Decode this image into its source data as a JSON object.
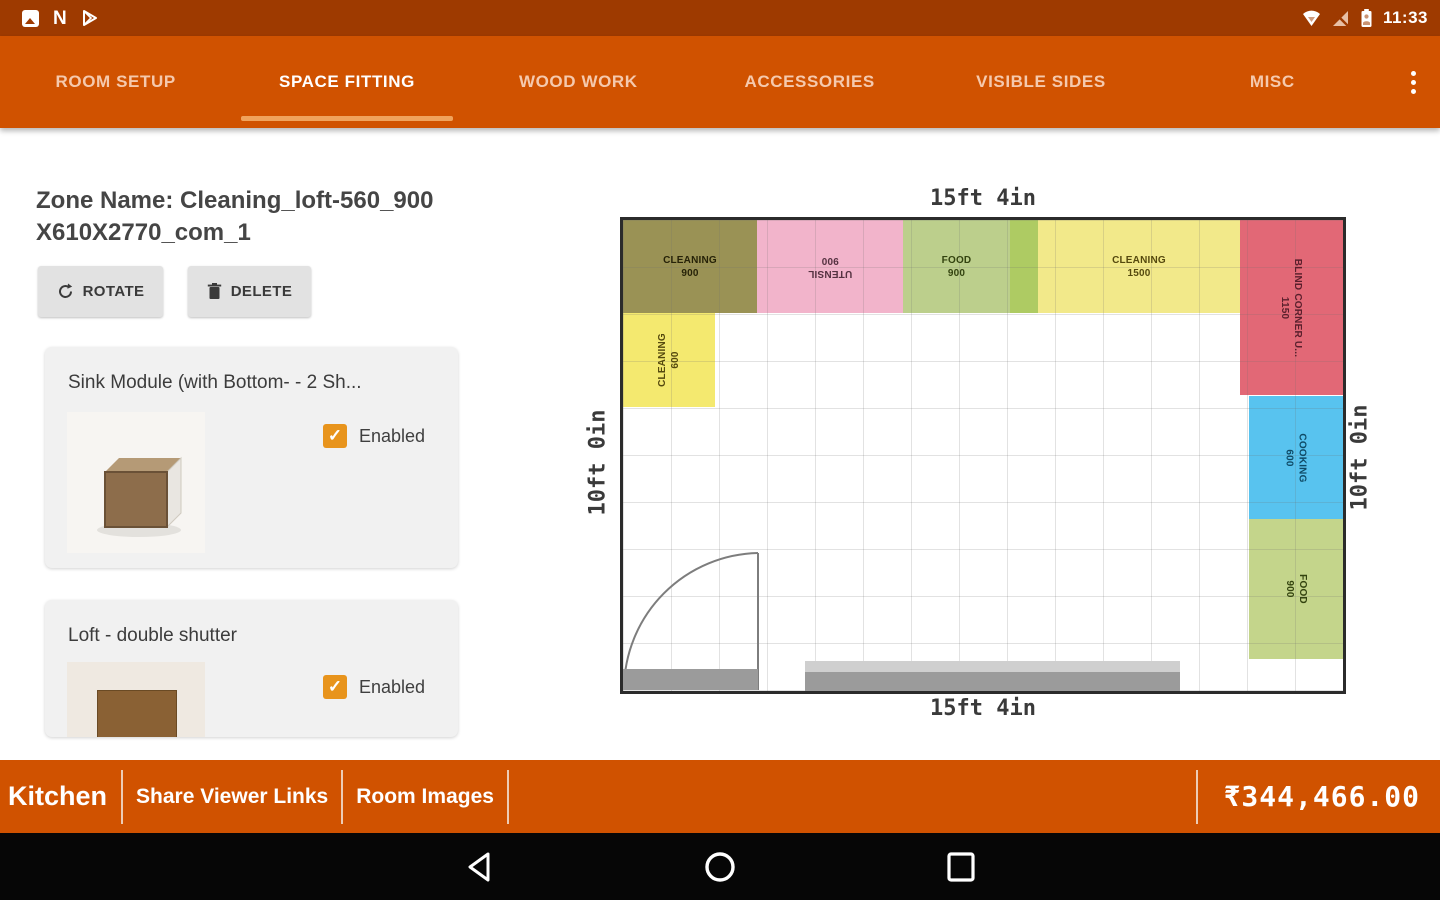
{
  "status_bar": {
    "time": "11:33",
    "left_icons": [
      "gallery-icon",
      "n-icon",
      "play-icon"
    ],
    "right_icons": [
      "wifi-icon",
      "no-signal-icon",
      "battery-icon"
    ]
  },
  "tab_bar": {
    "tabs": [
      {
        "label": "ROOM SETUP",
        "active": false
      },
      {
        "label": "SPACE FITTING",
        "active": true
      },
      {
        "label": "WOOD WORK",
        "active": false
      },
      {
        "label": "ACCESSORIES",
        "active": false
      },
      {
        "label": "VISIBLE SIDES",
        "active": false
      },
      {
        "label": "MISC",
        "active": false
      }
    ],
    "accent_color": "#f0a35c"
  },
  "zone_panel": {
    "zone_name_line1": "Zone Name: Cleaning_loft-560_900",
    "zone_name_line2": "X610X2770_com_1",
    "rotate_label": "ROTATE",
    "delete_label": "DELETE",
    "cards": [
      {
        "title": "Sink Module (with Bottom- - 2 Sh...",
        "checkbox_label": "Enabled",
        "checked": true
      },
      {
        "title": "Loft - double shutter",
        "checkbox_label": "Enabled",
        "checked": true
      }
    ],
    "checkbox_color": "#e8941c",
    "check_glyph": "✓"
  },
  "floor_plan": {
    "dim_top": "15ft 4in",
    "dim_bottom": "15ft 4in",
    "dim_left": "10ft 0in",
    "dim_right": "10ft 0in",
    "zones": [
      {
        "name": "CLEANING",
        "size": "900",
        "color": "#9a9255",
        "text_color": "#262208"
      },
      {
        "name": "UTENSIL",
        "size": "900",
        "color": "#f2b4cb",
        "text_color": "#553241"
      },
      {
        "name": "FOOD",
        "size": "900",
        "color": "#bccf8c",
        "text_color": "#33430f"
      },
      {
        "name": "",
        "size": "",
        "color": "#aecb63",
        "text_color": "#33430f"
      },
      {
        "name": "CLEANING",
        "size": "1500",
        "color": "#f2e98a",
        "text_color": "#55490e"
      },
      {
        "name": "BLIND CORNER U...",
        "size": "1150",
        "color": "#e26876",
        "text_color": "#5a1f2c"
      },
      {
        "name": "CLEANING",
        "size": "600",
        "color": "#f4e96f",
        "text_color": "#55490e"
      },
      {
        "name": "COOKING",
        "size": "600",
        "color": "#58c3ef",
        "text_color": "#0f4a66"
      },
      {
        "name": "FOOD",
        "size": "900",
        "color": "#c4d58b",
        "text_color": "#33430f"
      }
    ]
  },
  "bottom_bar": {
    "room_name": "Kitchen",
    "share_viewer_label": "Share Viewer Links",
    "room_images_label": "Room Images",
    "price": "₹344,466.00",
    "bar_color": "#d05200"
  }
}
